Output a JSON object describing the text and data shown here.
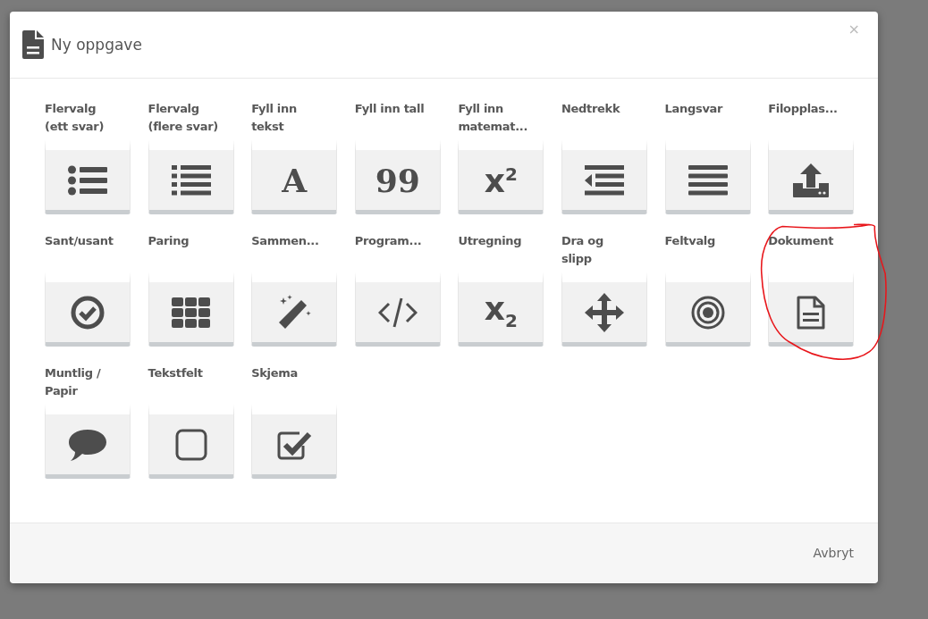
{
  "dialog": {
    "title": "Ny oppgave",
    "close": "×",
    "task_types": [
      {
        "label": "Flervalg\n(ett svar)",
        "kind": "icon",
        "circled": false
      },
      {
        "label": "Flervalg\n(flere svar)",
        "kind": "icon",
        "circled": false
      },
      {
        "label": "Fyll inn\ntekst",
        "kind": "glyph",
        "glyph": "A",
        "circled": false
      },
      {
        "label": "Fyll inn tall",
        "kind": "glyph",
        "glyph": "99",
        "circled": false
      },
      {
        "label": "Fyll inn\nmatemat...",
        "kind": "glyph",
        "glyph": "x$^{2}$",
        "circled": false
      },
      {
        "label": "Nedtrekk",
        "kind": "icon",
        "circled": false
      },
      {
        "label": "Langsvar",
        "kind": "icon",
        "circled": false
      },
      {
        "label": "Filopplas...",
        "kind": "icon",
        "circled": false
      },
      {
        "label": "Sant/usant",
        "kind": "icon",
        "circled": false
      },
      {
        "label": "Paring",
        "kind": "icon",
        "circled": false
      },
      {
        "label": "Sammen...",
        "kind": "icon",
        "circled": false
      },
      {
        "label": "Program...",
        "kind": "icon",
        "circled": false
      },
      {
        "label": "Utregning",
        "kind": "glyph",
        "glyph": "x$_{2}$",
        "circled": false
      },
      {
        "label": "Dra og\nslipp",
        "kind": "icon",
        "circled": false
      },
      {
        "label": "Feltvalg",
        "kind": "icon",
        "circled": false
      },
      {
        "label": "Dokument",
        "kind": "icon",
        "circled": true
      },
      {
        "label": "Muntlig /\nPapir",
        "kind": "icon",
        "circled": false
      },
      {
        "label": "Tekstfelt",
        "kind": "icon",
        "circled": false
      },
      {
        "label": "Skjema",
        "kind": "icon",
        "circled": false
      }
    ],
    "cancel_button": "Avbryt"
  }
}
